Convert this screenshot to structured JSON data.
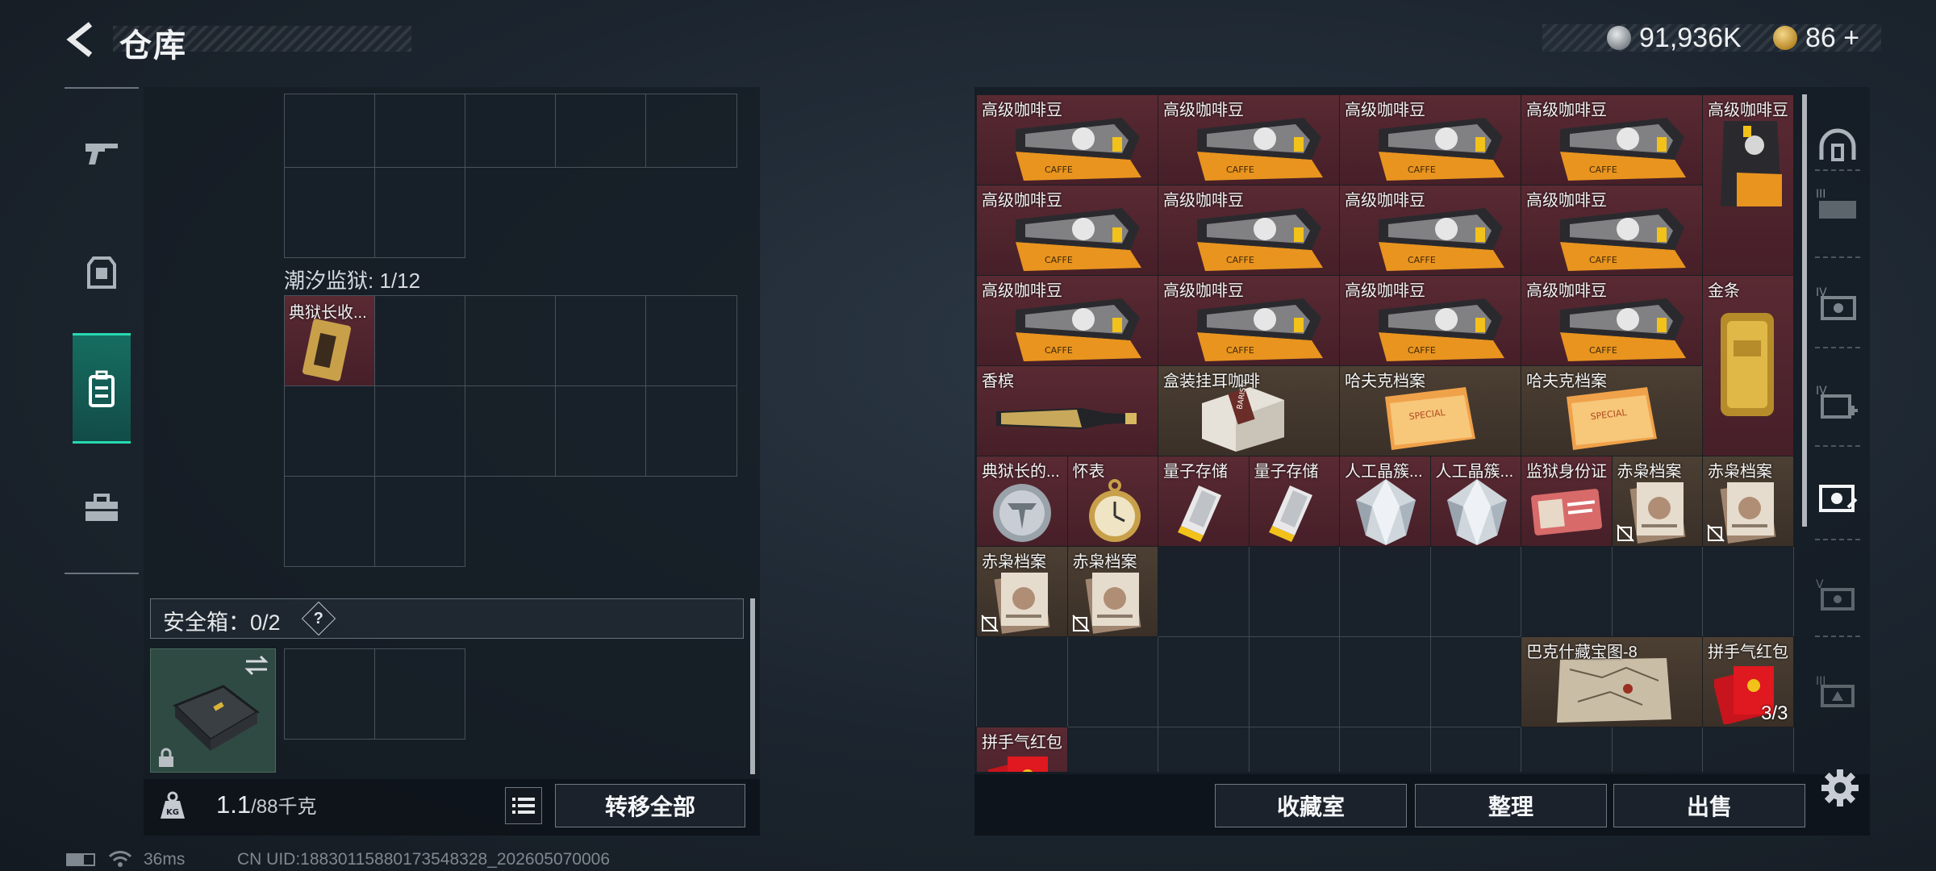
{
  "header": {
    "title": "仓库"
  },
  "currency": {
    "silver": "91,936K",
    "gold": "86",
    "gold_add": "+"
  },
  "left_nav": {
    "items": [
      "weapon-icon",
      "armor-icon",
      "backpack-icon",
      "toolbox-icon"
    ],
    "active": 2
  },
  "left_panel": {
    "section_label": "潮汐监狱: 1/12",
    "section_item": "典狱长收...",
    "safe_box_label": "安全箱：0/2",
    "help": "?",
    "weight_value": "1.1",
    "weight_capacity": "/88千克",
    "transfer_all": "转移全部"
  },
  "storage": {
    "items": [
      {
        "name": "高级咖啡豆",
        "art": "coffee-bag"
      },
      {
        "name": "高级咖啡豆",
        "art": "coffee-bag"
      },
      {
        "name": "高级咖啡豆",
        "art": "coffee-bag"
      },
      {
        "name": "高级咖啡豆",
        "art": "coffee-bag"
      },
      {
        "name": "高级咖啡豆",
        "art": "coffee-bag-tall"
      },
      {
        "name": "高级咖啡豆",
        "art": "coffee-bag"
      },
      {
        "name": "高级咖啡豆",
        "art": "coffee-bag"
      },
      {
        "name": "高级咖啡豆",
        "art": "coffee-bag"
      },
      {
        "name": "高级咖啡豆",
        "art": "coffee-bag"
      },
      {
        "name": "高级咖啡豆",
        "art": "coffee-bag"
      },
      {
        "name": "高级咖啡豆",
        "art": "coffee-bag"
      },
      {
        "name": "高级咖啡豆",
        "art": "coffee-bag"
      },
      {
        "name": "高级咖啡豆",
        "art": "coffee-bag"
      },
      {
        "name": "金条",
        "art": "gold-bar"
      },
      {
        "name": "香槟",
        "art": "champagne"
      },
      {
        "name": "盒装挂耳咖啡",
        "art": "coffee-box"
      },
      {
        "name": "哈夫克档案",
        "art": "folder"
      },
      {
        "name": "哈夫克档案",
        "art": "folder"
      },
      {
        "name": "典狱长的...",
        "art": "medal"
      },
      {
        "name": "怀表",
        "art": "pocket-watch"
      },
      {
        "name": "量子存储",
        "art": "usb"
      },
      {
        "name": "量子存储",
        "art": "usb"
      },
      {
        "name": "人工晶簇...",
        "art": "crystal"
      },
      {
        "name": "人工晶簇...",
        "art": "crystal"
      },
      {
        "name": "监狱身份证",
        "art": "id-card"
      },
      {
        "name": "赤枭档案",
        "art": "files"
      },
      {
        "name": "赤枭档案",
        "art": "files"
      },
      {
        "name": "赤枭档案",
        "art": "files"
      },
      {
        "name": "赤枭档案",
        "art": "files"
      },
      {
        "name": "巴克什藏宝图-8",
        "art": "map"
      },
      {
        "name": "拼手气红包",
        "art": "red-envelope",
        "count": "3/3"
      },
      {
        "name": "拼手气红包",
        "art": "red-envelope"
      }
    ]
  },
  "right_nav": {
    "items": [
      "helmet-icon",
      "armor-iii-icon",
      "armor-iv-icon",
      "medkit-iv-icon",
      "armor-selected-icon",
      "armor-v-icon",
      "armor-iii-b-icon"
    ]
  },
  "actions": {
    "collection_room": "收藏室",
    "sort": "整理",
    "sell": "出售"
  },
  "status": {
    "ping": "36ms",
    "uid": "CN UID:18830115880173548328_202605070006"
  }
}
